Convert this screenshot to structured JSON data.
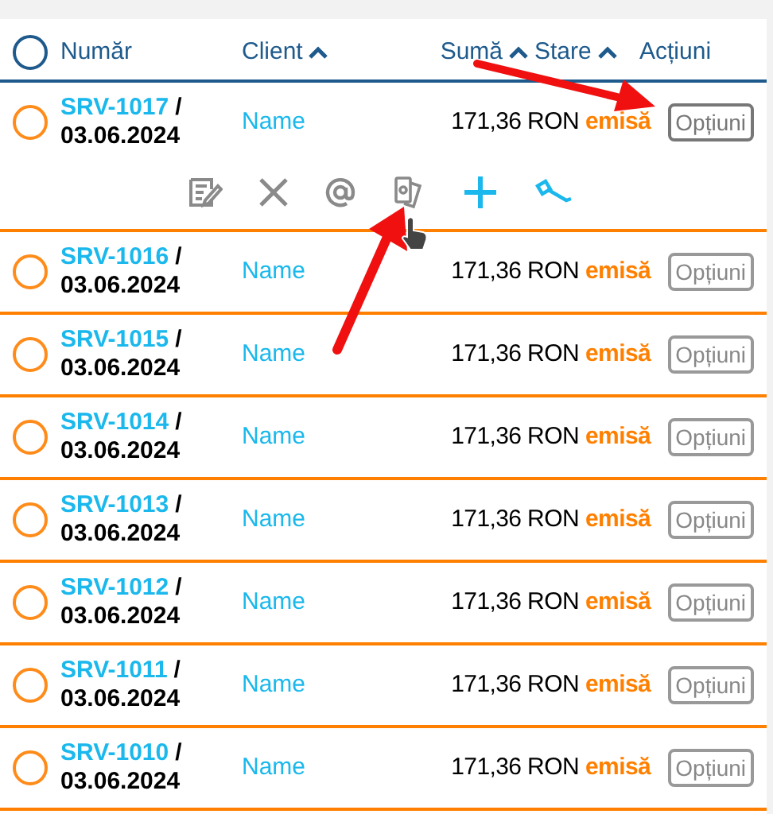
{
  "header": {
    "select_all": {
      "checked": false
    },
    "columns": [
      {
        "label": "Număr",
        "sortable": false
      },
      {
        "label": "Client",
        "sortable": true
      },
      {
        "label": "Sumă",
        "sortable": true
      },
      {
        "label": "Stare",
        "sortable": true
      },
      {
        "label": "Acțiuni",
        "sortable": false
      }
    ]
  },
  "rows": [
    {
      "number": "SRV-1017",
      "separator": "/",
      "date": "03.06.2024",
      "client": "Name",
      "amount": "171,36 RON",
      "status": "emisă",
      "button": "Opțiuni",
      "expanded": true,
      "checked": false
    },
    {
      "number": "SRV-1016",
      "separator": "/",
      "date": "03.06.2024",
      "client": "Name",
      "amount": "171,36 RON",
      "status": "emisă",
      "button": "Opțiuni",
      "expanded": false,
      "checked": false
    },
    {
      "number": "SRV-1015",
      "separator": "/",
      "date": "03.06.2024",
      "client": "Name",
      "amount": "171,36 RON",
      "status": "emisă",
      "button": "Opțiuni",
      "expanded": false,
      "checked": false
    },
    {
      "number": "SRV-1014",
      "separator": "/",
      "date": "03.06.2024",
      "client": "Name",
      "amount": "171,36 RON",
      "status": "emisă",
      "button": "Opțiuni",
      "expanded": false,
      "checked": false
    },
    {
      "number": "SRV-1013",
      "separator": "/",
      "date": "03.06.2024",
      "client": "Name",
      "amount": "171,36 RON",
      "status": "emisă",
      "button": "Opțiuni",
      "expanded": false,
      "checked": false
    },
    {
      "number": "SRV-1012",
      "separator": "/",
      "date": "03.06.2024",
      "client": "Name",
      "amount": "171,36 RON",
      "status": "emisă",
      "button": "Opțiuni",
      "expanded": false,
      "checked": false
    },
    {
      "number": "SRV-1011",
      "separator": "/",
      "date": "03.06.2024",
      "client": "Name",
      "amount": "171,36 RON",
      "status": "emisă",
      "button": "Opțiuni",
      "expanded": false,
      "checked": false
    },
    {
      "number": "SRV-1010",
      "separator": "/",
      "date": "03.06.2024",
      "client": "Name",
      "amount": "171,36 RON",
      "status": "emisă",
      "button": "Opțiuni",
      "expanded": false,
      "checked": false
    }
  ],
  "row_actions": [
    {
      "kind": "edit"
    },
    {
      "kind": "delete"
    },
    {
      "kind": "email"
    },
    {
      "kind": "payment"
    },
    {
      "kind": "add"
    },
    {
      "kind": "auction"
    }
  ]
}
